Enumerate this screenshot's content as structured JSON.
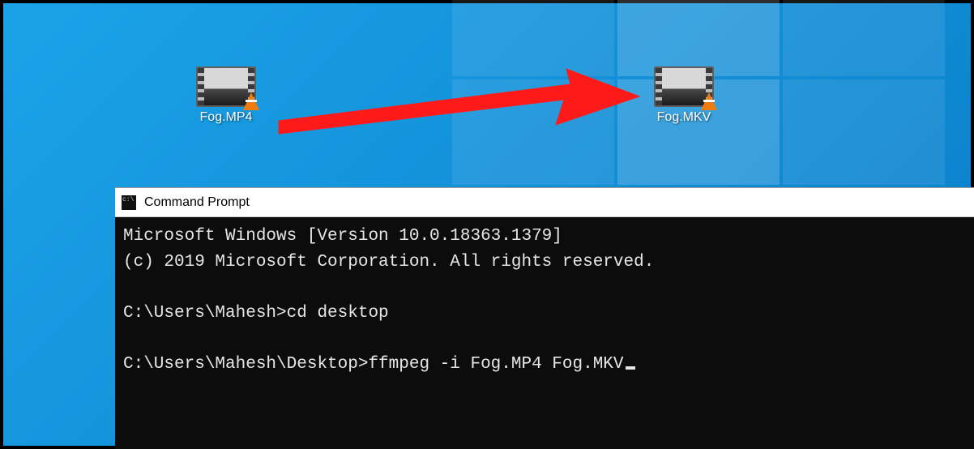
{
  "desktop": {
    "icons": [
      {
        "label": "Fog.MP4",
        "kind": "video-file"
      },
      {
        "label": "Fog.MKV",
        "kind": "video-file"
      }
    ]
  },
  "annotation": {
    "arrow_color": "#ff1a1a",
    "direction": "left-to-right"
  },
  "cmd": {
    "title": "Command Prompt",
    "lines": {
      "banner1": "Microsoft Windows [Version 10.0.18363.1379]",
      "banner2": "(c) 2019 Microsoft Corporation. All rights reserved.",
      "blank1": "",
      "prompt1": "C:\\Users\\Mahesh>",
      "cmd1": "cd desktop",
      "blank2": "",
      "prompt2": "C:\\Users\\Mahesh\\Desktop>",
      "cmd2": "ffmpeg -i Fog.MP4 Fog.MKV"
    }
  }
}
